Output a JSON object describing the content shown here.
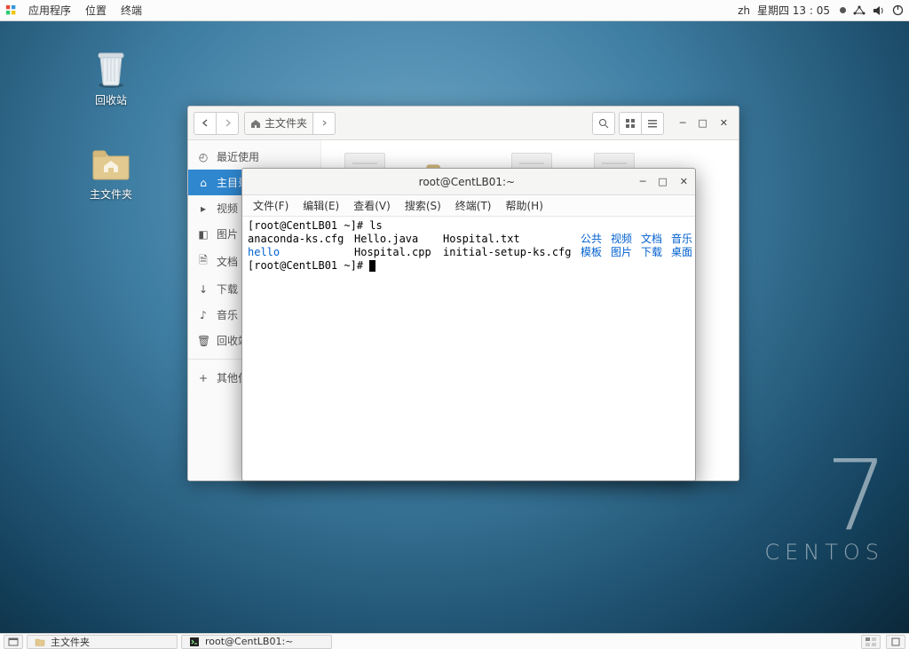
{
  "panel": {
    "menus": {
      "apps": "应用程序",
      "places": "位置",
      "terminal": "终端"
    },
    "input_method": "zh",
    "clock": "星期四 13 : 05"
  },
  "desktop": {
    "trash": "回收站",
    "home": "主文件夹"
  },
  "branding": {
    "version": "7",
    "name": "CENTOS"
  },
  "filemgr": {
    "path_label": "主文件夹",
    "sidebar": {
      "recent": "最近使用",
      "home": "主目录",
      "videos": "视频",
      "pictures": "图片",
      "documents": "文档",
      "downloads": "下载",
      "music": "音乐",
      "trash": "回收站",
      "other": "其他位"
    }
  },
  "terminal": {
    "title": "root@CentLB01:~",
    "menus": {
      "file": "文件(F)",
      "edit": "编辑(E)",
      "view": "查看(V)",
      "search": "搜索(S)",
      "terminal_m": "终端(T)",
      "help": "帮助(H)"
    },
    "lines": {
      "l1_prompt": "[root@CentLB01 ~]# ",
      "l1_cmd": "ls",
      "row1_c1": "anaconda-ks.cfg",
      "row1_c2": "Hello.java",
      "row1_c3": "Hospital.txt",
      "row1_d1": "公共",
      "row1_d2": "视频",
      "row1_d3": "文档",
      "row1_d4": "音乐",
      "row2_c1": "hello",
      "row2_c2": "Hospital.cpp",
      "row2_c3": "initial-setup-ks.cfg",
      "row2_d1": "模板",
      "row2_d2": "图片",
      "row2_d3": "下载",
      "row2_d4": "桌面",
      "l4_prompt": "[root@CentLB01 ~]# "
    }
  },
  "taskbar": {
    "task1": "主文件夹",
    "task2": "root@CentLB01:~"
  }
}
